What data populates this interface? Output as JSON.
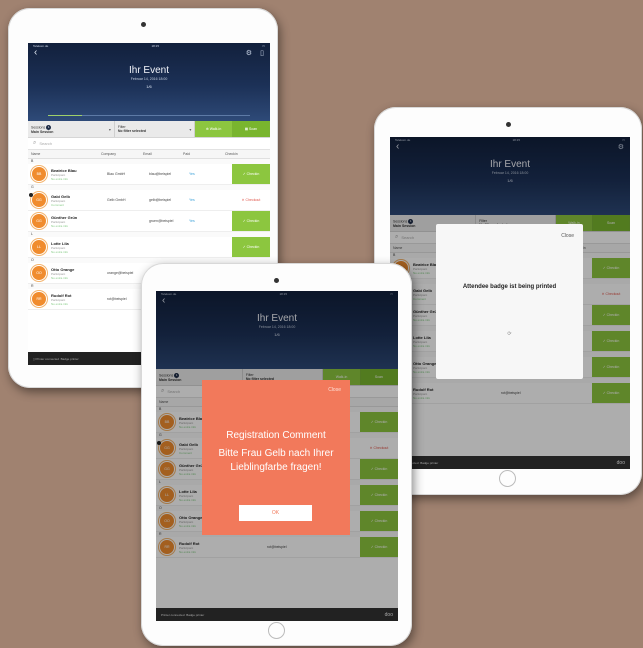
{
  "app": {
    "event_title": "Ihr Event",
    "event_date": "Februar 14, 2016 18:00",
    "count": "1/6",
    "progress": 0.17,
    "status_left": "Telekom.de",
    "status_time": "18:15"
  },
  "toolbar": {
    "sessions_label": "Sessions",
    "sessions_value": "Main Session",
    "sessions_badge": "1",
    "filter_label": "Filter",
    "filter_value": "No filter selected",
    "walkin_label": "Walk-in",
    "scan_label": "Scan"
  },
  "search": {
    "placeholder": "Search"
  },
  "columns": {
    "name": "Name",
    "company": "Company",
    "email": "Email",
    "paid": "Paid",
    "checkin": "Checkin"
  },
  "attendees": [
    {
      "letter": "B",
      "initials": "BB",
      "name": "Beatrice Blau",
      "role": "Participant",
      "note": "No extra info",
      "company": "Blau GmbH",
      "email": "blau@beispiel",
      "paid": "Yes",
      "status": "Checkin"
    },
    {
      "letter": "G",
      "initials": "GG",
      "name": "Gabi Gelb",
      "role": "Participant",
      "note": "Comment",
      "company": "Gelb GmbH",
      "email": "gelb@beispiel",
      "paid": "Yes",
      "status": "Checkout"
    },
    {
      "letter": "",
      "initials": "GG",
      "name": "Günther Grün",
      "role": "Participant",
      "note": "No extra info",
      "company": "",
      "email": "gruen@beispiel",
      "paid": "Yes",
      "status": "Checkin"
    },
    {
      "letter": "L",
      "initials": "LL",
      "name": "Lotte Lila",
      "role": "Participant",
      "note": "No extra info",
      "company": "",
      "email": "",
      "paid": "",
      "status": "Checkin"
    },
    {
      "letter": "O",
      "initials": "OO",
      "name": "Otto Orange",
      "role": "Participant",
      "note": "No extra info",
      "company": "orange@beispiel",
      "email": "",
      "paid": "",
      "status": "Checkin"
    },
    {
      "letter": "R",
      "initials": "RR",
      "name": "Rudolf Rot",
      "role": "Participant",
      "note": "No extra info",
      "company": "rot@beispiel",
      "email": "",
      "paid": "",
      "status": "Checkin"
    }
  ],
  "footer": {
    "left": "Printer connected",
    "right": "Badge printer",
    "brand": "doo"
  },
  "registration_modal": {
    "close": "Close",
    "title": "Registration Comment",
    "message": "Bitte Frau Gelb nach Ihrer Lieblingfarbe fragen!",
    "ok": "OK"
  },
  "print_modal": {
    "close": "Close",
    "message": "Attendee badge ist being printed",
    "spinner": "⟳"
  },
  "colors": {
    "background": "#a08270",
    "accent_green": "#8cc63f",
    "modal_orange": "#f2795b",
    "header_navy": "#1c3157",
    "avatar": "#f08c2e"
  }
}
